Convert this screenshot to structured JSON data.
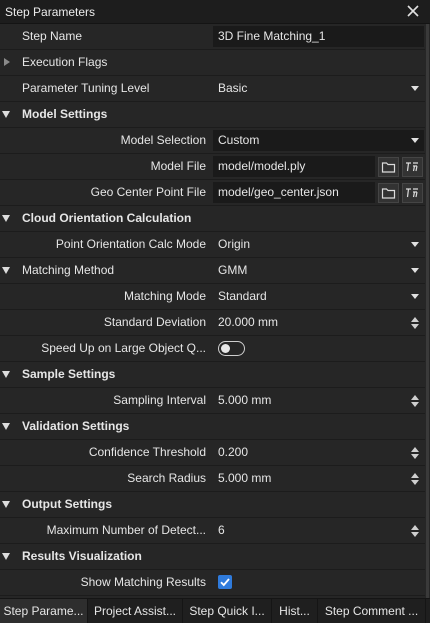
{
  "window": {
    "title": "Step Parameters"
  },
  "general": {
    "step_name_label": "Step Name",
    "step_name_value": "3D Fine Matching_1",
    "execution_flags_label": "Execution Flags",
    "tuning_level_label": "Parameter Tuning Level",
    "tuning_level_value": "Basic"
  },
  "model_settings": {
    "header": "Model Settings",
    "model_selection_label": "Model Selection",
    "model_selection_value": "Custom",
    "model_file_label": "Model File",
    "model_file_value": "model/model.ply",
    "geo_center_label": "Geo Center Point File",
    "geo_center_value": "model/geo_center.json"
  },
  "cloud_orientation": {
    "header": "Cloud Orientation Calculation",
    "calc_mode_label": "Point Orientation Calc Mode",
    "calc_mode_value": "Origin"
  },
  "matching": {
    "header_label": "Matching Method",
    "header_value": "GMM",
    "mode_label": "Matching Mode",
    "mode_value": "Standard",
    "std_dev_label": "Standard Deviation",
    "std_dev_value": "20.000 mm",
    "speed_up_label": "Speed Up on Large Object Q...",
    "speed_up_on": false
  },
  "sample_settings": {
    "header": "Sample Settings",
    "interval_label": "Sampling Interval",
    "interval_value": "5.000 mm"
  },
  "validation_settings": {
    "header": "Validation Settings",
    "confidence_label": "Confidence Threshold",
    "confidence_value": "0.200",
    "radius_label": "Search Radius",
    "radius_value": "5.000 mm"
  },
  "output_settings": {
    "header": "Output Settings",
    "max_detect_label": "Maximum Number of Detect...",
    "max_detect_value": "6"
  },
  "results_visualization": {
    "header": "Results Visualization",
    "show_results_label": "Show Matching Results",
    "show_results_checked": true
  },
  "tabs": [
    {
      "label": "Step Parame..."
    },
    {
      "label": "Project Assist..."
    },
    {
      "label": "Step Quick I..."
    },
    {
      "label": "Hist..."
    },
    {
      "label": "Step Comment ..."
    }
  ],
  "icons": {
    "close": "close-icon",
    "folder": "folder-icon",
    "variable": "variable-icon",
    "expand": "triangle-down-icon",
    "collapse": "triangle-right-icon"
  },
  "colors": {
    "background": "#262626",
    "input_bg": "#1a1a1a",
    "accent": "#2f7bdc"
  }
}
